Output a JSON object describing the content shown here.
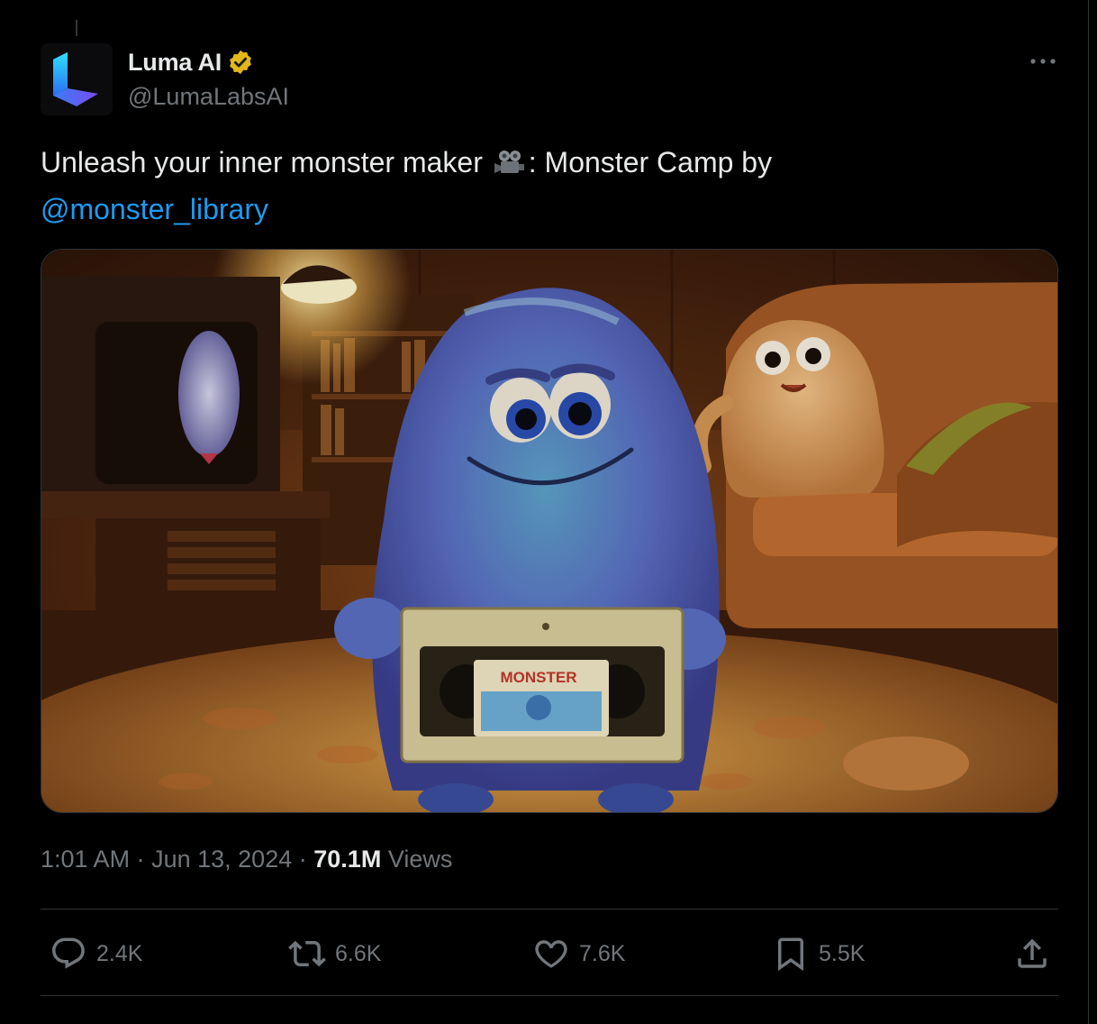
{
  "author": {
    "display_name": "Luma AI",
    "handle": "@LumaLabsAI",
    "verified": true,
    "verified_color": "#e2b719"
  },
  "tweet": {
    "text_before": "Unleash your inner monster maker",
    "emoji": "movie-camera",
    "text_after": ": Monster Camp by",
    "mention": "@monster_library"
  },
  "media": {
    "type": "video-thumbnail",
    "tape_label": "MONSTER"
  },
  "meta": {
    "time": "1:01 AM",
    "separator": "·",
    "date": "Jun 13, 2024",
    "views_count": "70.1M",
    "views_label": "Views"
  },
  "actions": {
    "replies": "2.4K",
    "reposts": "6.6K",
    "likes": "7.6K",
    "bookmarks": "5.5K"
  },
  "colors": {
    "background": "#000000",
    "text": "#e7e9ea",
    "secondary": "#71767b",
    "link": "#1d9bf0",
    "border": "#2f3336"
  }
}
